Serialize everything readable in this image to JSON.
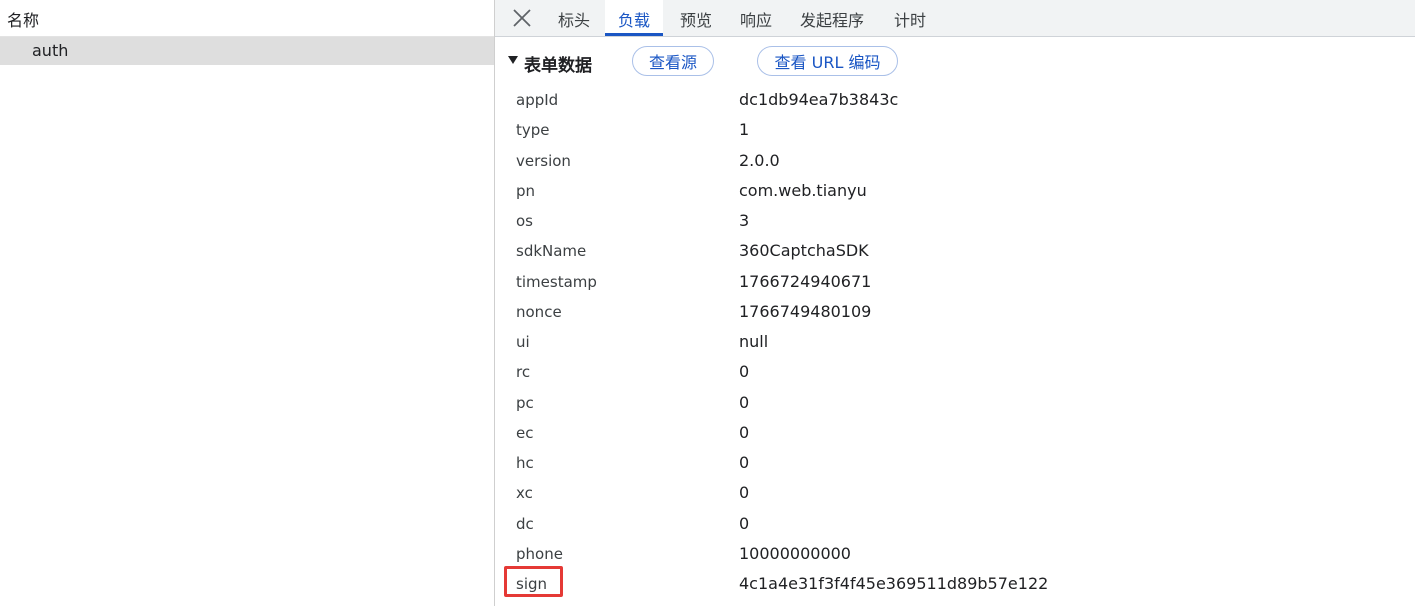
{
  "list": {
    "header": "名称",
    "items": [
      {
        "name": "auth"
      }
    ]
  },
  "tabs": [
    {
      "label": "标头"
    },
    {
      "label": "负载"
    },
    {
      "label": "预览"
    },
    {
      "label": "响应"
    },
    {
      "label": "发起程序"
    },
    {
      "label": "计时"
    }
  ],
  "active_tab": "负载",
  "form": {
    "title": "表单数据",
    "view_source_label": "查看源",
    "view_url_encoded_label": "查看 URL 编码",
    "rows": [
      {
        "key": "appId",
        "value": "dc1db94ea7b3843c"
      },
      {
        "key": "type",
        "value": "1"
      },
      {
        "key": "version",
        "value": "2.0.0"
      },
      {
        "key": "pn",
        "value": "com.web.tianyu"
      },
      {
        "key": "os",
        "value": "3"
      },
      {
        "key": "sdkName",
        "value": "360CaptchaSDK"
      },
      {
        "key": "timestamp",
        "value": "1766724940671"
      },
      {
        "key": "nonce",
        "value": "1766749480109"
      },
      {
        "key": "ui",
        "value": "null"
      },
      {
        "key": "rc",
        "value": "0"
      },
      {
        "key": "pc",
        "value": "0"
      },
      {
        "key": "ec",
        "value": "0"
      },
      {
        "key": "hc",
        "value": "0"
      },
      {
        "key": "xc",
        "value": "0"
      },
      {
        "key": "dc",
        "value": "0"
      },
      {
        "key": "phone",
        "value": "10000000000"
      },
      {
        "key": "sign",
        "value": "4c1a4e31f3f4f45e369511d89b57e122",
        "highlighted": true
      }
    ]
  },
  "colors": {
    "accent": "#1a56c4",
    "highlight_border": "#e53935",
    "selected_row": "#dedede"
  },
  "icons": {
    "close": "close-icon",
    "collapse": "triangle-down-icon"
  }
}
